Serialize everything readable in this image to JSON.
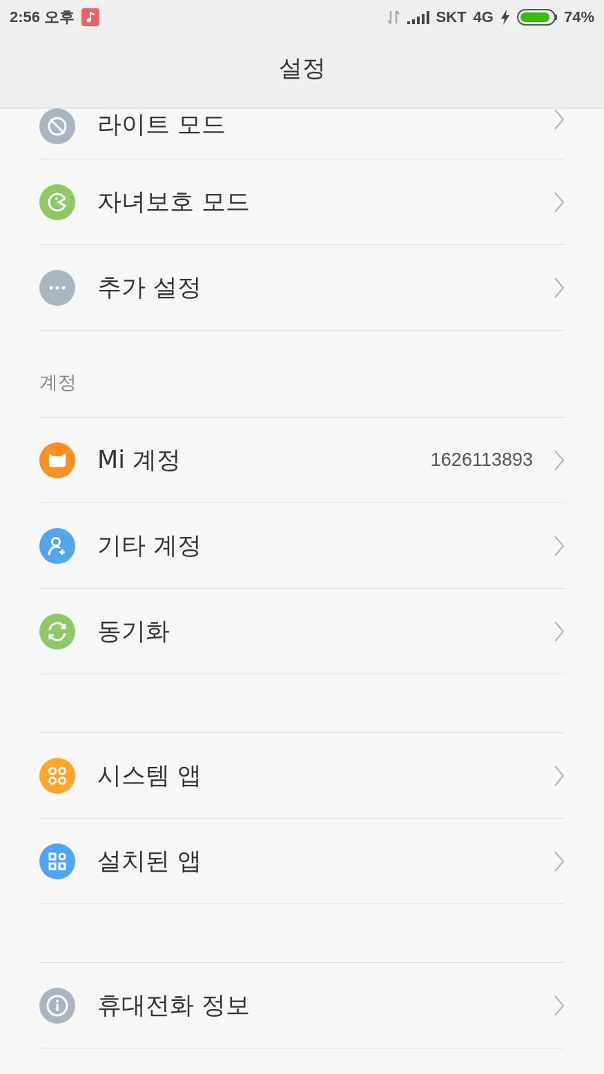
{
  "status_bar": {
    "time": "2:56 오후",
    "carrier": "SKT",
    "network": "4G",
    "battery_text": "74%",
    "charging": true
  },
  "title": "설정",
  "groups": [
    {
      "items": [
        {
          "kind": "lite",
          "label": "라이트 모드",
          "color": "#a9b6c1",
          "cut": true
        },
        {
          "kind": "kids",
          "label": "자녀보호 모드",
          "color": "#8fc866"
        },
        {
          "kind": "more",
          "label": "추가 설정",
          "color": "#a9b6c1"
        }
      ]
    },
    {
      "header": "계정",
      "items": [
        {
          "kind": "mi",
          "label": "Mi 계정",
          "value": "1626113893",
          "color": "#fb8f25"
        },
        {
          "kind": "accounts",
          "label": "기타 계정",
          "color": "#52a6e9"
        },
        {
          "kind": "sync",
          "label": "동기화",
          "color": "#8fc866"
        }
      ]
    },
    {
      "items": [
        {
          "kind": "system-apps",
          "label": "시스템 앱",
          "color": "#ffa52a"
        },
        {
          "kind": "installed-apps",
          "label": "설치된 앱",
          "color": "#4ea5f4"
        }
      ]
    },
    {
      "items": [
        {
          "kind": "info",
          "label": "휴대전화 정보",
          "color": "#a9b6c1"
        }
      ]
    }
  ]
}
